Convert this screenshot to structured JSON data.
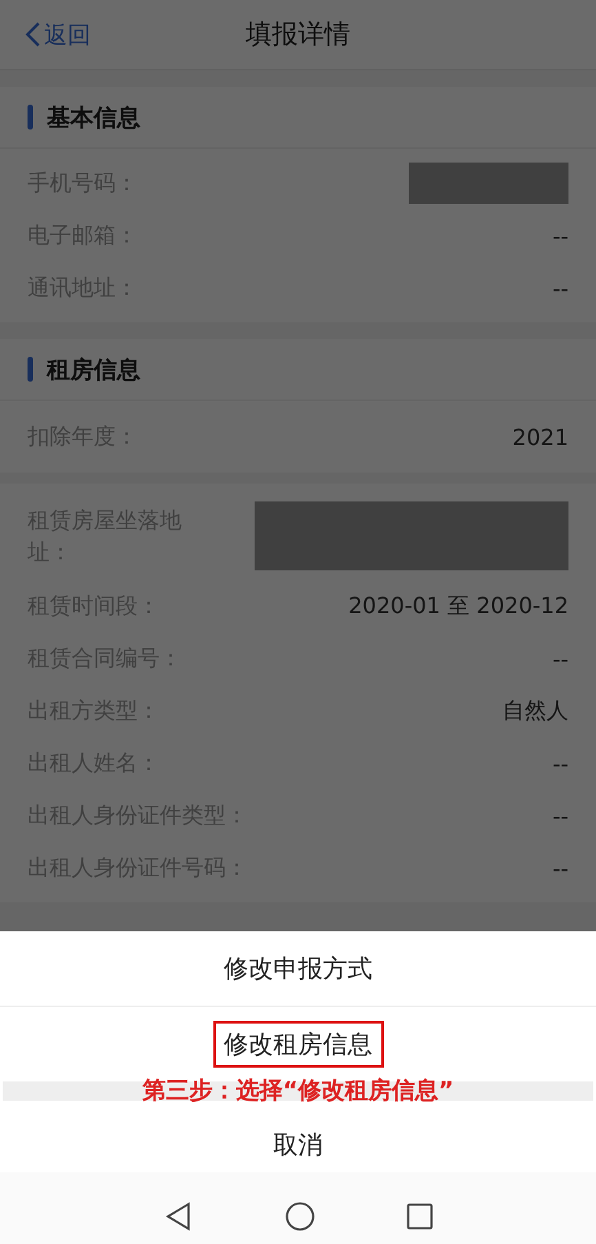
{
  "header": {
    "back": "返回",
    "title": "填报详情"
  },
  "sections": [
    {
      "title": "基本信息",
      "rows": [
        {
          "kind": "redacted",
          "label": "手机号码："
        },
        {
          "kind": "text",
          "label": "电子邮箱：",
          "value": "--"
        },
        {
          "kind": "text",
          "label": "通讯地址：",
          "value": "--"
        }
      ]
    },
    {
      "title": "租房信息",
      "rows": [
        {
          "kind": "text",
          "label": "扣除年度：",
          "value": "2021",
          "separated": true
        },
        {
          "kind": "redacted",
          "label": "租赁房屋坐落地址："
        },
        {
          "kind": "text",
          "label": "租赁时间段：",
          "value": "2020-01 至 2020-12"
        },
        {
          "kind": "text",
          "label": "租赁合同编号：",
          "value": "--"
        },
        {
          "kind": "text",
          "label": "出租方类型：",
          "value": "自然人"
        },
        {
          "kind": "text",
          "label": "出租人姓名：",
          "value": "--"
        },
        {
          "kind": "text",
          "label": "出租人身份证件类型：",
          "value": "--"
        },
        {
          "kind": "text",
          "label": "出租人身份证件号码：",
          "value": "--"
        }
      ]
    }
  ],
  "sheet": {
    "options": [
      {
        "label": "修改申报方式",
        "annotated": false
      },
      {
        "label": "修改租房信息",
        "annotated": true
      }
    ],
    "annotation": "第三步：选择“修改租房信息”",
    "cancel": "取消"
  }
}
